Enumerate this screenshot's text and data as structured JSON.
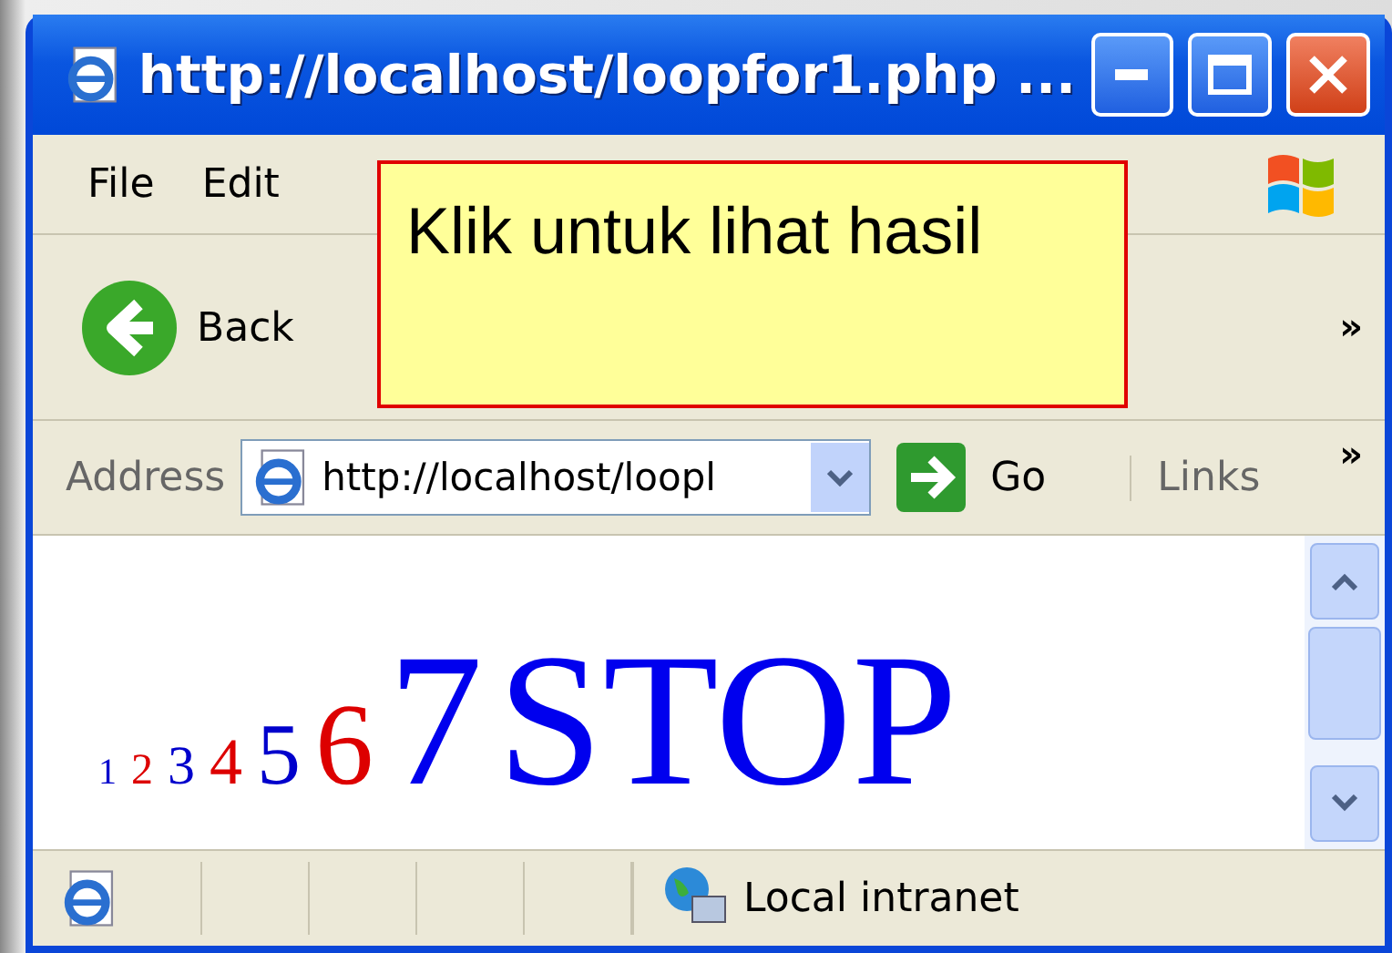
{
  "window": {
    "title": "http://localhost/loopfor1.php ..."
  },
  "menu_bar": {
    "items": [
      "File",
      "Edit"
    ]
  },
  "toolbar": {
    "back_label": "Back",
    "overflow": "»"
  },
  "address_bar": {
    "label": "Address",
    "url": "http://localhost/loopl",
    "go_label": "Go",
    "links_label": "Links",
    "overflow": "»"
  },
  "page": {
    "items": [
      {
        "text": "1",
        "color": "#0000cc"
      },
      {
        "text": "2",
        "color": "#dd0000"
      },
      {
        "text": "3",
        "color": "#0000cc"
      },
      {
        "text": "4",
        "color": "#dd0000"
      },
      {
        "text": "5",
        "color": "#0000cc"
      },
      {
        "text": "6",
        "color": "#dd0000"
      },
      {
        "text": "7",
        "color": "#0000ee"
      },
      {
        "text": "STOP",
        "color": "#0000ee"
      }
    ]
  },
  "status_bar": {
    "zone": "Local intranet"
  },
  "callout": {
    "text": "Klik untuk lihat hasil"
  }
}
